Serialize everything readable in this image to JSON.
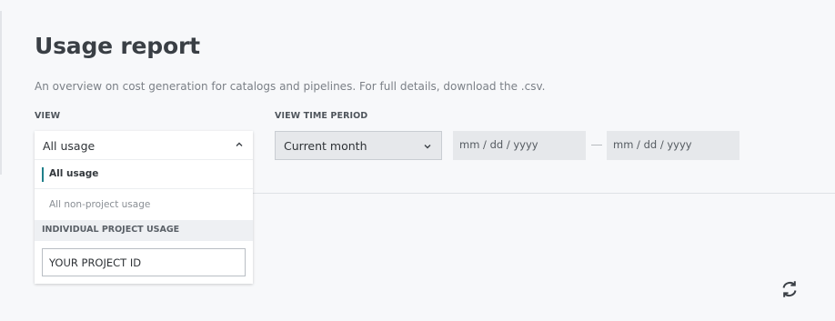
{
  "header": {
    "title": "Usage report",
    "subtitle": "An overview on cost generation for catalogs and pipelines. For full details, download the .csv."
  },
  "view": {
    "label": "VIEW",
    "selected": "All usage",
    "options": [
      {
        "label": "All usage",
        "selected": true
      },
      {
        "label": "All non-project usage",
        "selected": false
      }
    ],
    "group_header": "INDIVIDUAL PROJECT USAGE",
    "project_input": {
      "value": "YOUR PROJECT ID",
      "placeholder": ""
    }
  },
  "period": {
    "label": "VIEW TIME PERIOD",
    "selected": "Current month",
    "start_placeholder": "mm / dd / yyyy",
    "end_placeholder": "mm / dd / yyyy"
  },
  "icons": {
    "refresh": "refresh-icon",
    "chevron_up": "chevron-up-icon",
    "chevron_down": "chevron-down-icon"
  },
  "colors": {
    "accent": "#1f7f8a",
    "background": "#f7f8fa"
  }
}
